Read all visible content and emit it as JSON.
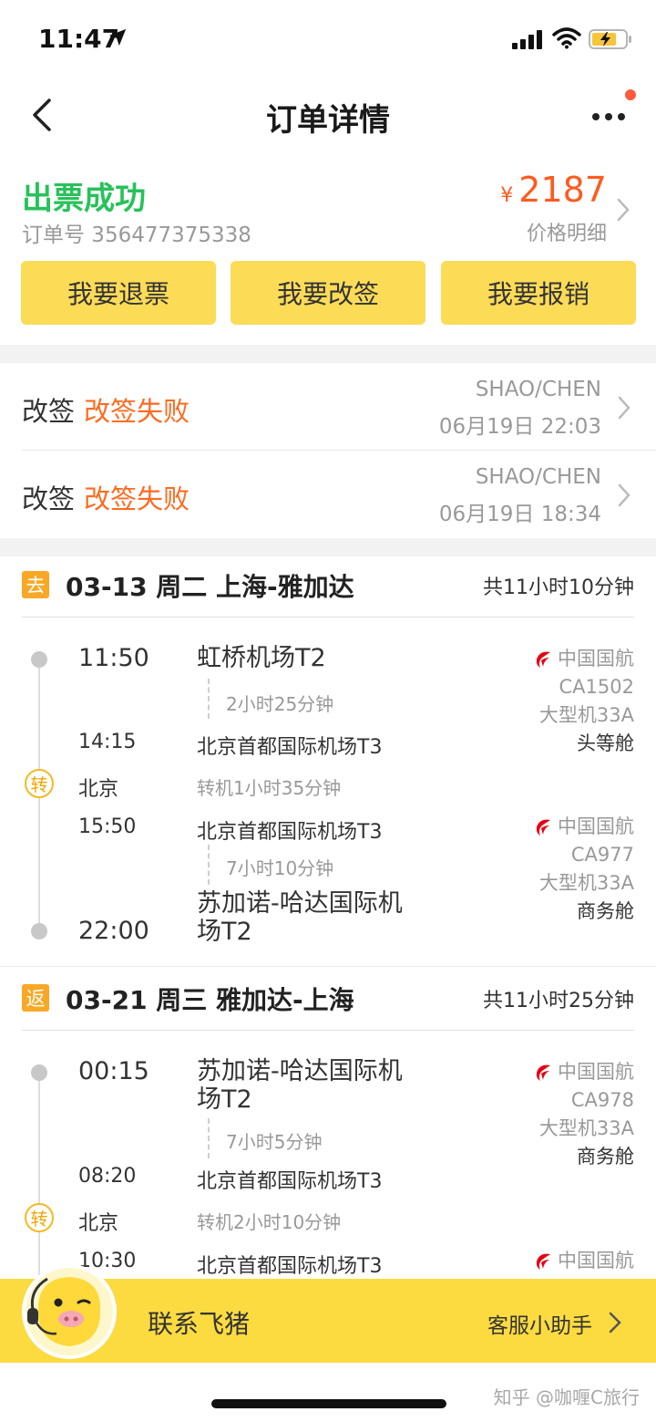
{
  "status_bar": {
    "time": "11:47"
  },
  "nav": {
    "title": "订单详情"
  },
  "order": {
    "status": "出票成功",
    "order_number": "订单号 356477375338",
    "price_symbol": "¥",
    "price": "2187",
    "price_detail": "价格明细"
  },
  "actions": [
    {
      "label": "我要退票"
    },
    {
      "label": "我要改签"
    },
    {
      "label": "我要报销"
    }
  ],
  "changes": [
    {
      "type": "改签",
      "result": "改签失败",
      "passenger": "SHAO/CHEN",
      "time": "06月19日 22:03"
    },
    {
      "type": "改签",
      "result": "改签失败",
      "passenger": "SHAO/CHEN",
      "time": "06月19日 18:34"
    }
  ],
  "segments": [
    {
      "badge": "去",
      "title": "03-13 周二 上海-雅加达",
      "duration": "共11小时10分钟",
      "legs": [
        {
          "dep_time": "11:50",
          "dep_airport": "虹桥机场T2",
          "flight_duration": "2小时25分钟",
          "arr_time": "14:15",
          "arr_airport": "北京首都国际机场T3",
          "airline": "中国国航",
          "flight_no": "CA1502",
          "aircraft": "大型机33A",
          "cabin": "头等舱"
        },
        {
          "dep_time": "15:50",
          "dep_airport": "北京首都国际机场T3",
          "flight_duration": "7小时10分钟",
          "arr_time": "22:00",
          "arr_airport_line1": "苏加诺-哈达国际机",
          "arr_airport_line2": "场T2",
          "airline": "中国国航",
          "flight_no": "CA977",
          "aircraft": "大型机33A",
          "cabin": "商务舱"
        }
      ],
      "transfer": {
        "badge": "转",
        "city": "北京",
        "info": "转机1小时35分钟"
      }
    },
    {
      "badge": "返",
      "title": "03-21 周三 雅加达-上海",
      "duration": "共11小时25分钟",
      "legs": [
        {
          "dep_time": "00:15",
          "dep_airport_line1": "苏加诺-哈达国际机",
          "dep_airport_line2": "场T2",
          "flight_duration": "7小时5分钟",
          "arr_time": "08:20",
          "arr_airport": "北京首都国际机场T3",
          "airline": "中国国航",
          "flight_no": "CA978",
          "aircraft": "大型机33A",
          "cabin": "商务舱"
        },
        {
          "dep_time": "10:30",
          "dep_airport": "北京首都国际机场T3",
          "airline": "中国国航"
        }
      ],
      "transfer": {
        "badge": "转",
        "city": "北京",
        "info": "转机2小时10分钟"
      }
    }
  ],
  "contact_bar": {
    "label": "联系飞猪",
    "service": "客服小助手"
  },
  "watermark": "知乎 @咖喱C旅行",
  "colors": {
    "success": "#27c259",
    "price": "#ff5a1f",
    "button": "#fcdb57",
    "fail": "#ff6a1f",
    "contact_bar": "#fcdb41",
    "airline_red": "#e60012"
  },
  "icons": [
    "back-arrow-icon",
    "more-icon",
    "chevron-right-icon",
    "airline-logo-icon",
    "mascot-icon",
    "location-arrow-icon",
    "signal-icon",
    "wifi-icon",
    "battery-icon"
  ]
}
